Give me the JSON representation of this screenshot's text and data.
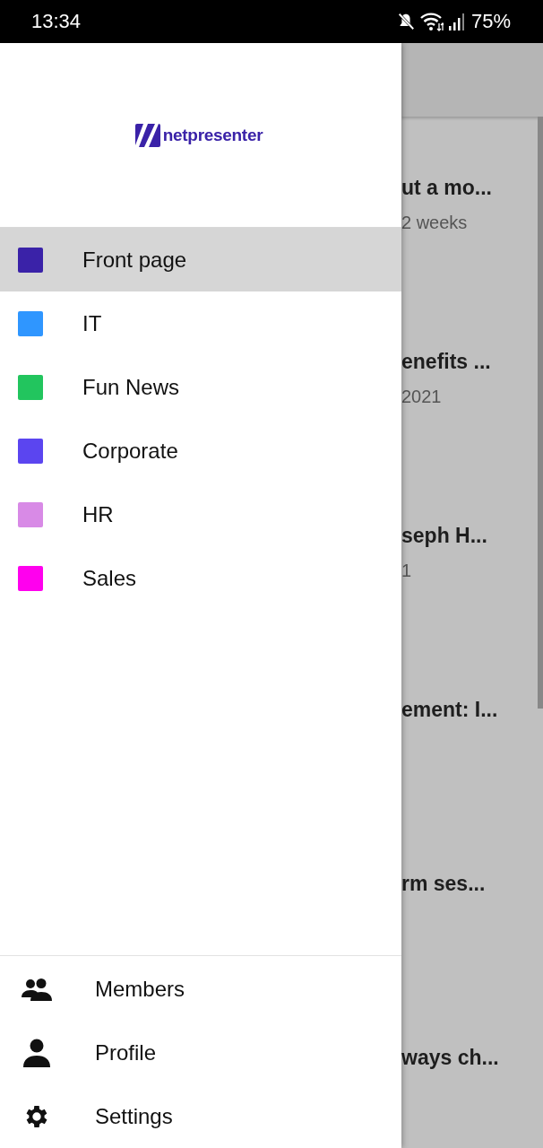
{
  "status_bar": {
    "time": "13:34",
    "battery": "75%"
  },
  "drawer": {
    "logo_text": "netpresenter",
    "categories": [
      {
        "label": "Front page",
        "color": "#3a22a8",
        "selected": true
      },
      {
        "label": "IT",
        "color": "#2f96ff",
        "selected": false
      },
      {
        "label": "Fun News",
        "color": "#22c55e",
        "selected": false
      },
      {
        "label": "Corporate",
        "color": "#5b45f0",
        "selected": false
      },
      {
        "label": "HR",
        "color": "#d88ae6",
        "selected": false
      },
      {
        "label": "Sales",
        "color": "#ff00ee",
        "selected": false
      }
    ],
    "footer": [
      {
        "label": "Members",
        "kind": "members"
      },
      {
        "label": "Profile",
        "kind": "profile"
      },
      {
        "label": "Settings",
        "kind": "settings"
      }
    ]
  },
  "background_list": [
    {
      "title": "ut a mo...",
      "subtitle": "2 weeks"
    },
    {
      "title": "enefits ...",
      "subtitle": "2021"
    },
    {
      "title": "seph H...",
      "subtitle": "1"
    },
    {
      "title": "ement: I..."
    },
    {
      "title": "rm ses..."
    },
    {
      "title": "ways ch..."
    }
  ]
}
